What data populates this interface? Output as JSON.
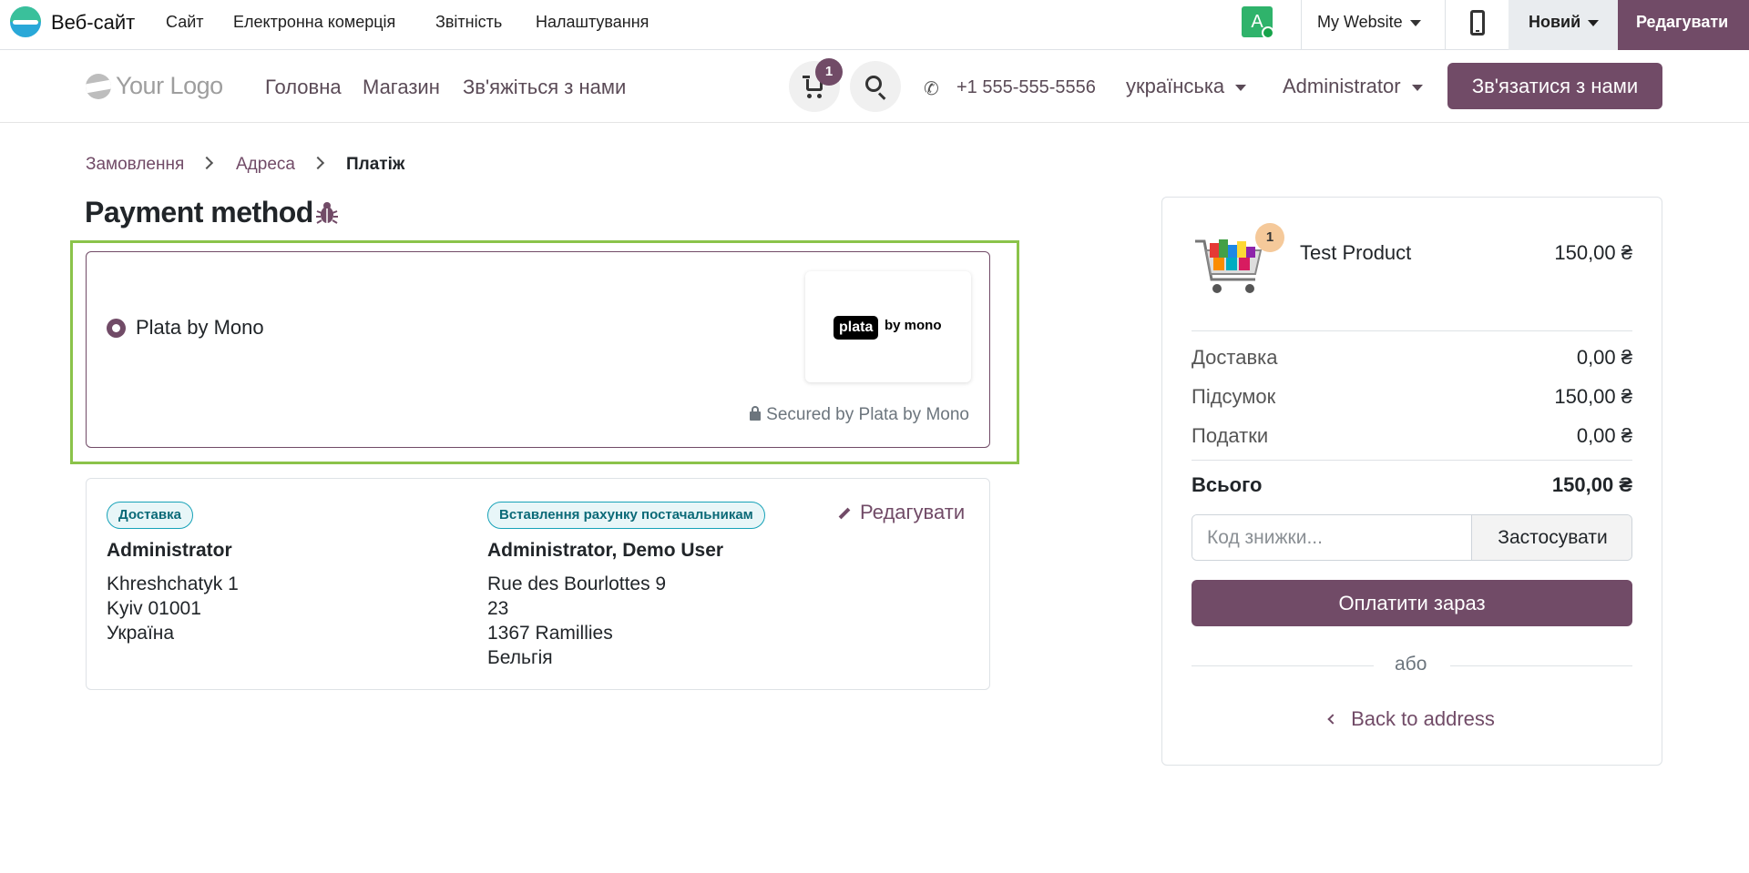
{
  "admin_bar": {
    "app_name": "Веб-сайт",
    "menu": [
      "Сайт",
      "Електронна комерція",
      "Звітність",
      "Налаштування"
    ],
    "avatar_letter": "A",
    "website_selector": "My Website",
    "new_label": "Новий",
    "edit_label": "Редагувати",
    "accent_color": "#714b67"
  },
  "header": {
    "logo_text": "Your Logo",
    "nav": [
      "Головна",
      "Магазин",
      "Зв'яжіться з нами"
    ],
    "cart_count": "1",
    "phone": "+1 555-555-5556",
    "language": "українська",
    "user": "Administrator",
    "contact_button": "Зв'язатися з нами"
  },
  "breadcrumb": {
    "items": [
      "Замовлення",
      "Адреса",
      "Платіж"
    ]
  },
  "payment": {
    "title": "Payment method",
    "provider_name": "Plata by Mono",
    "logo_pill": "plata",
    "logo_suffix": "by mono",
    "secured_text": "Secured by Plata by Mono"
  },
  "addresses": {
    "delivery_badge": "Доставка",
    "billing_badge": "Вставлення рахунку постачальникам",
    "edit_label": "Редагувати",
    "delivery_name": "Administrator",
    "delivery_lines": [
      "Khreshchatyk 1",
      "Kyiv 01001",
      "Україна"
    ],
    "billing_name": "Administrator, Demo User",
    "billing_lines": [
      "Rue des Bourlottes 9",
      "23",
      "1367 Ramillies",
      "Бельгія"
    ]
  },
  "summary": {
    "product_name": "Test Product",
    "product_qty": "1",
    "product_price": "150,00 ₴",
    "rows": [
      {
        "label": "Доставка",
        "value": "0,00 ₴"
      },
      {
        "label": "Підсумок",
        "value": "150,00 ₴"
      },
      {
        "label": "Податки",
        "value": "0,00 ₴"
      }
    ],
    "total_label": "Всього",
    "total_value": "150,00 ₴",
    "promo_placeholder": "Код знижки...",
    "promo_button": "Застосувати",
    "pay_button": "Оплатити зараз",
    "or_text": "або",
    "back_link": "Back to address"
  }
}
